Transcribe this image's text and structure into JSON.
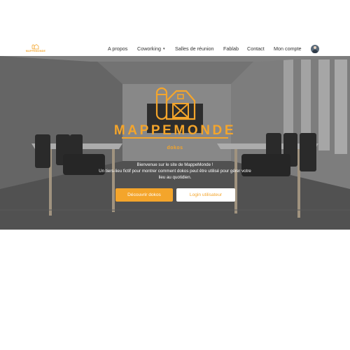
{
  "brand": {
    "logo_text": "MAPPEMONDE",
    "title": "MAPPEMONDE",
    "subtitle": "dokos"
  },
  "nav": {
    "items": [
      {
        "label": "A propos"
      },
      {
        "label": "Coworking",
        "caret": "▾"
      },
      {
        "label": "Salles de réunion"
      },
      {
        "label": "Fablab"
      },
      {
        "label": "Contact"
      },
      {
        "label": "Mon compte"
      }
    ]
  },
  "hero": {
    "line1": "Bienvenue sur le site de MappeMonde !",
    "line2": "Un tiers-lieu fictif pour montrer comment dokos peut être utilisé pour gérer votre",
    "line3": "lieu au quotidien.",
    "primary_button": "Découvrir dokos",
    "secondary_button": "Login utilisateur"
  },
  "colors": {
    "accent": "#f4a52b",
    "nav_text": "#333333",
    "hero_text": "#ffffff"
  },
  "icons": {
    "logo": "barn-logo-icon",
    "avatar": "user-avatar"
  }
}
